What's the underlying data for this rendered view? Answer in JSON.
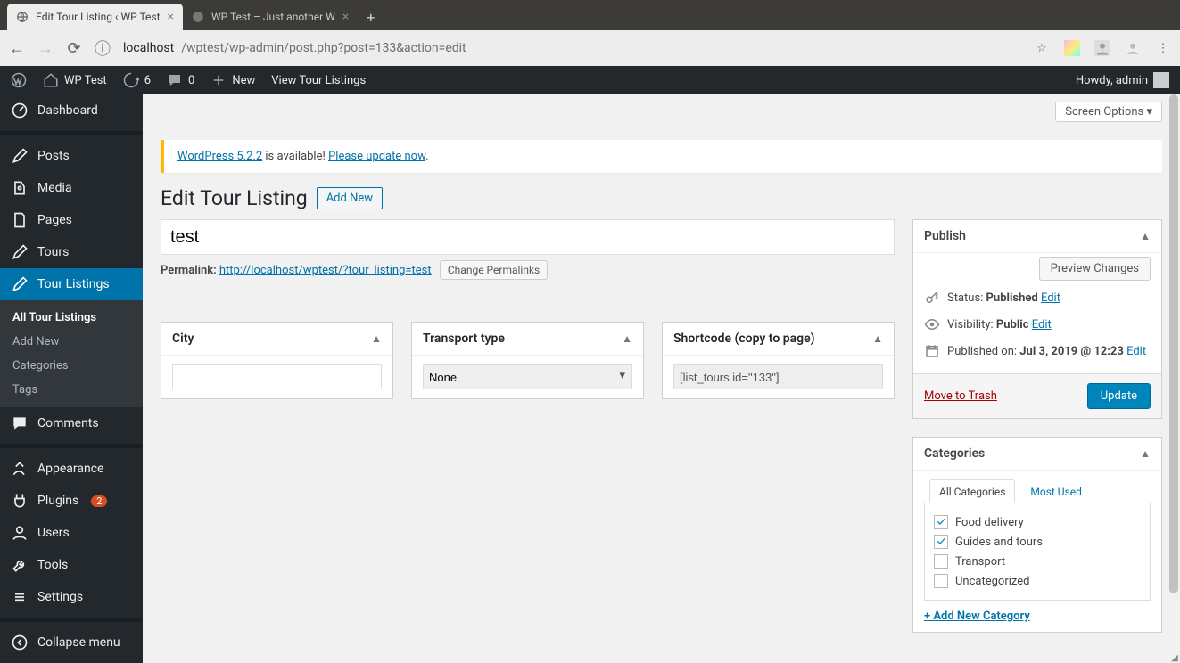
{
  "browser": {
    "tabs": [
      {
        "title": "Edit Tour Listing ‹ WP Test",
        "active": true
      },
      {
        "title": "WP Test – Just another W",
        "active": false
      }
    ],
    "url_host": "localhost",
    "url_rest": "/wptest/wp-admin/post.php?post=133&action=edit"
  },
  "adminbar": {
    "site_title": "WP Test",
    "update_count": "6",
    "comment_count": "0",
    "new_label": "New",
    "view_label": "View Tour Listings",
    "howdy": "Howdy, admin"
  },
  "sidebar": {
    "items": {
      "dashboard": "Dashboard",
      "posts": "Posts",
      "media": "Media",
      "pages": "Pages",
      "tours": "Tours",
      "tour_listings": "Tour Listings",
      "comments": "Comments",
      "appearance": "Appearance",
      "plugins": "Plugins",
      "plugins_count": "2",
      "users": "Users",
      "tools": "Tools",
      "settings": "Settings",
      "collapse": "Collapse menu"
    },
    "submenu": {
      "all": "All Tour Listings",
      "add": "Add New",
      "cat": "Categories",
      "tags": "Tags"
    }
  },
  "screen_options": "Screen Options",
  "notice": {
    "a": "WordPress 5.2.2",
    "b": " is available! ",
    "c": "Please update now",
    "d": "."
  },
  "heading": "Edit Tour Listing",
  "add_new": "Add New",
  "title_value": "test",
  "permalink": {
    "label": "Permalink:",
    "url": "http://localhost/wptest/?tour_listing=test",
    "change": "Change Permalinks"
  },
  "metaboxes": {
    "city": {
      "title": "City",
      "value": ""
    },
    "transport": {
      "title": "Transport type",
      "value": "None"
    },
    "shortcode": {
      "title": "Shortcode (copy to page)",
      "value": "[list_tours id=\"133\"]"
    }
  },
  "publish": {
    "title": "Publish",
    "preview": "Preview Changes",
    "status_label": "Status: ",
    "status_value": "Published",
    "vis_label": "Visibility: ",
    "vis_value": "Public",
    "pub_label": "Published on: ",
    "pub_value": "Jul 3, 2019 @ 12:23",
    "edit_link": "Edit",
    "trash": "Move to Trash",
    "update": "Update"
  },
  "categories": {
    "title": "Categories",
    "tabs": {
      "all": "All Categories",
      "most": "Most Used"
    },
    "items": [
      {
        "label": "Food delivery",
        "checked": true
      },
      {
        "label": "Guides and tours",
        "checked": true
      },
      {
        "label": "Transport",
        "checked": false
      },
      {
        "label": "Uncategorized",
        "checked": false
      }
    ],
    "add": "+ Add New Category"
  }
}
